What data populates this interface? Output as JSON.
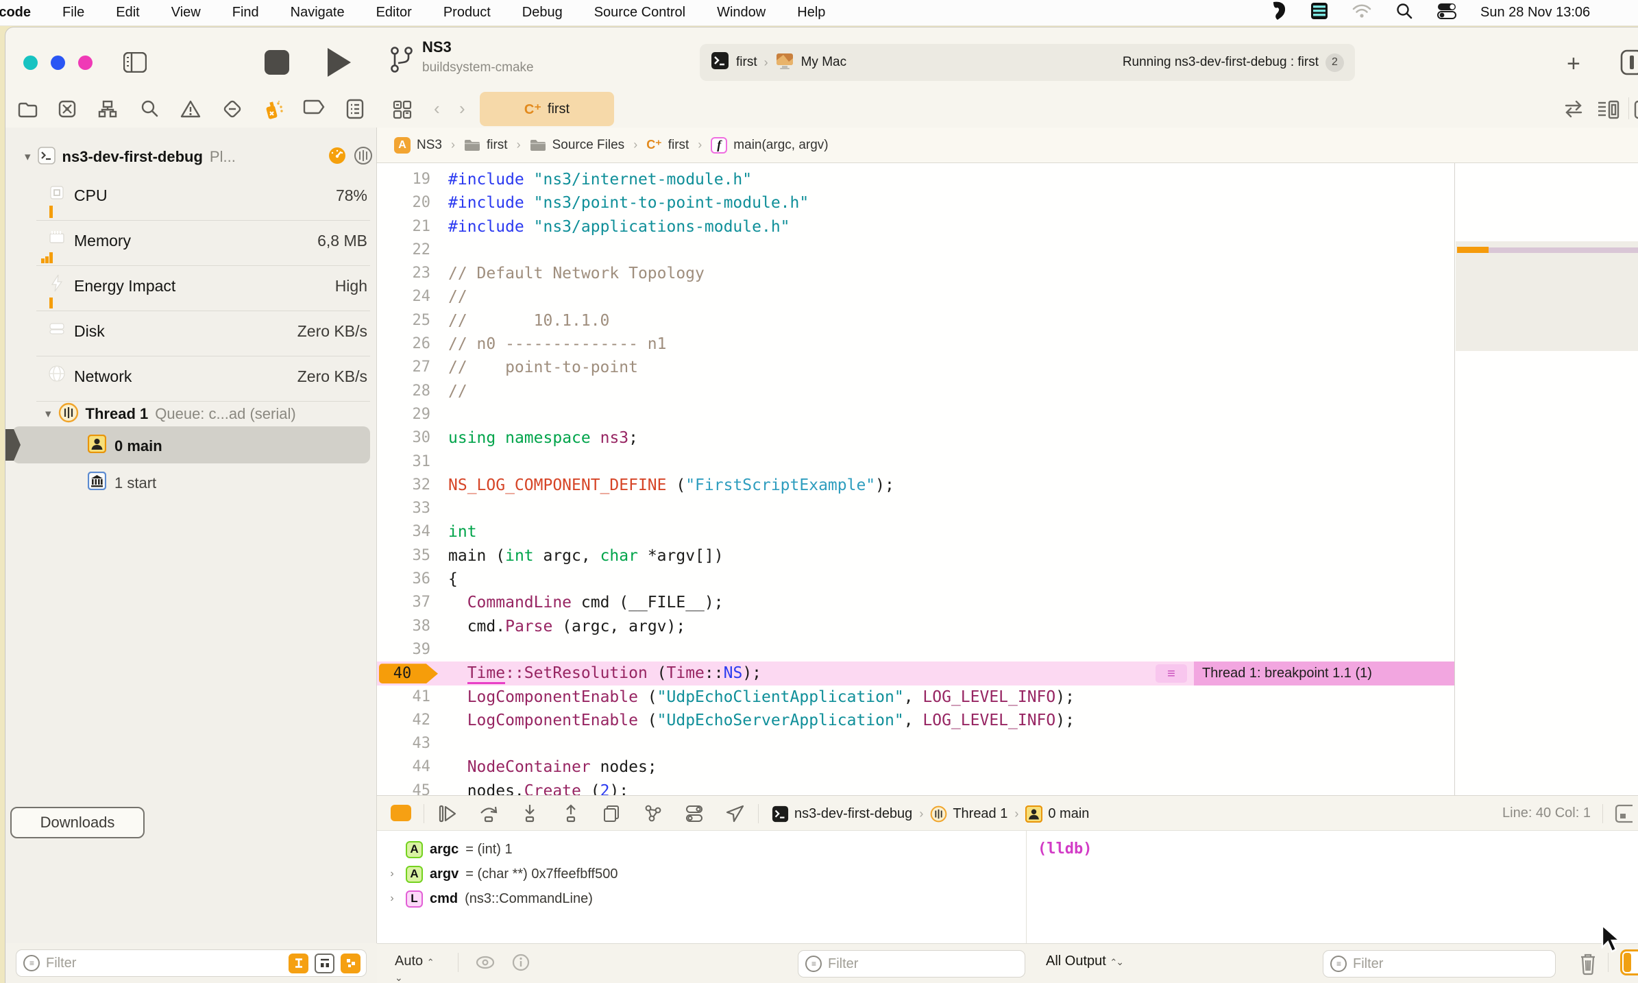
{
  "menu_bar": {
    "items": [
      "Xcode",
      "File",
      "Edit",
      "View",
      "Find",
      "Navigate",
      "Editor",
      "Product",
      "Debug",
      "Source Control",
      "Window",
      "Help"
    ],
    "clock": "Sun 28 Nov 13:06"
  },
  "toolbar": {
    "project": "NS3",
    "build_system": "buildsystem-cmake",
    "scheme_target": "first",
    "scheme_device": "My Mac",
    "run_status": "Running ns3-dev-first-debug : first",
    "run_badge": "2"
  },
  "tab_bar": {
    "active_icon": "C⁺",
    "active_label": "first"
  },
  "jump_bar": {
    "items": [
      {
        "icon": "app",
        "label": "NS3"
      },
      {
        "icon": "folder",
        "label": "first"
      },
      {
        "icon": "folder",
        "label": "Source Files"
      },
      {
        "icon": "cpp",
        "label": "first"
      },
      {
        "icon": "function",
        "label": "main(argc, argv)"
      }
    ]
  },
  "debug_navigator": {
    "process_name": "ns3-dev-first-debug",
    "process_suffix": "Pl...",
    "gauges": [
      {
        "icon": "cpu",
        "label": "CPU",
        "value": "78%",
        "bar": 18
      },
      {
        "icon": "memory",
        "label": "Memory",
        "value": "6,8 MB",
        "bar": 16
      },
      {
        "icon": "energy",
        "label": "Energy Impact",
        "value": "High",
        "bar": 16
      },
      {
        "icon": "disk",
        "label": "Disk",
        "value": "Zero KB/s",
        "bar": 0
      },
      {
        "icon": "network",
        "label": "Network",
        "value": "Zero KB/s",
        "bar": 0
      }
    ],
    "thread_name": "Thread 1",
    "thread_queue": "Queue: c...ad (serial)",
    "frames": [
      {
        "icon": "person",
        "label": "0 main",
        "selected": true
      },
      {
        "icon": "bank",
        "label": "1 start",
        "selected": false
      }
    ],
    "downloads_button": "Downloads",
    "filter_placeholder": "Filter"
  },
  "editor": {
    "breakpoint_annotation": "Thread 1: breakpoint 1.1 (1)",
    "lines": [
      {
        "n": 19,
        "t": [
          [
            "pre",
            "#include"
          ],
          [
            "pl",
            " "
          ],
          [
            "str",
            "\"ns3/internet-module.h\""
          ]
        ]
      },
      {
        "n": 20,
        "t": [
          [
            "pre",
            "#include"
          ],
          [
            "pl",
            " "
          ],
          [
            "str",
            "\"ns3/point-to-point-module.h\""
          ]
        ]
      },
      {
        "n": 21,
        "t": [
          [
            "pre",
            "#include"
          ],
          [
            "pl",
            " "
          ],
          [
            "str",
            "\"ns3/applications-module.h\""
          ]
        ]
      },
      {
        "n": 22,
        "t": []
      },
      {
        "n": 23,
        "t": [
          [
            "com",
            "// Default Network Topology"
          ]
        ]
      },
      {
        "n": 24,
        "t": [
          [
            "com",
            "//"
          ]
        ]
      },
      {
        "n": 25,
        "t": [
          [
            "com",
            "//       10.1.1.0"
          ]
        ]
      },
      {
        "n": 26,
        "t": [
          [
            "com",
            "// n0 -------------- n1"
          ]
        ]
      },
      {
        "n": 27,
        "t": [
          [
            "com",
            "//    point-to-point"
          ]
        ]
      },
      {
        "n": 28,
        "t": [
          [
            "com",
            "//"
          ]
        ]
      },
      {
        "n": 29,
        "t": []
      },
      {
        "n": 30,
        "t": [
          [
            "kw",
            "using"
          ],
          [
            "pl",
            " "
          ],
          [
            "kw",
            "namespace"
          ],
          [
            "pl",
            " "
          ],
          [
            "type",
            "ns3"
          ],
          [
            "pl",
            ";"
          ]
        ]
      },
      {
        "n": 31,
        "t": []
      },
      {
        "n": 32,
        "t": [
          [
            "macro",
            "NS_LOG_COMPONENT_DEFINE"
          ],
          [
            "pl",
            " ("
          ],
          [
            "str2",
            "\"FirstScriptExample\""
          ],
          [
            "pl",
            ");"
          ]
        ]
      },
      {
        "n": 33,
        "t": []
      },
      {
        "n": 34,
        "t": [
          [
            "kw",
            "int"
          ]
        ]
      },
      {
        "n": 35,
        "t": [
          [
            "pl",
            "main ("
          ],
          [
            "kw",
            "int"
          ],
          [
            "pl",
            " argc, "
          ],
          [
            "kw",
            "char"
          ],
          [
            "pl",
            " *argv[])"
          ]
        ]
      },
      {
        "n": 36,
        "t": [
          [
            "pl",
            "{"
          ]
        ]
      },
      {
        "n": 37,
        "t": [
          [
            "pl",
            "  "
          ],
          [
            "type",
            "CommandLine"
          ],
          [
            "pl",
            " cmd (__FILE__);"
          ]
        ]
      },
      {
        "n": 38,
        "t": [
          [
            "pl",
            "  cmd."
          ],
          [
            "type",
            "Parse"
          ],
          [
            "pl",
            " (argc, argv);"
          ]
        ]
      },
      {
        "n": 39,
        "t": []
      },
      {
        "n": 40,
        "bp": true,
        "t": [
          [
            "pl",
            "  "
          ],
          [
            "type-u",
            "Time"
          ],
          [
            "type",
            "::SetResolution"
          ],
          [
            "pl",
            " ("
          ],
          [
            "type",
            "Time"
          ],
          [
            "pl",
            "::"
          ],
          [
            "num",
            "NS"
          ],
          [
            "pl",
            ");"
          ]
        ]
      },
      {
        "n": 41,
        "t": [
          [
            "pl",
            "  "
          ],
          [
            "type",
            "LogComponentEnable"
          ],
          [
            "pl",
            " ("
          ],
          [
            "str",
            "\"UdpEchoClientApplication\""
          ],
          [
            "pl",
            ", "
          ],
          [
            "type",
            "LOG_LEVEL_INFO"
          ],
          [
            "pl",
            ");"
          ]
        ]
      },
      {
        "n": 42,
        "t": [
          [
            "pl",
            "  "
          ],
          [
            "type",
            "LogComponentEnable"
          ],
          [
            "pl",
            " ("
          ],
          [
            "str",
            "\"UdpEchoServerApplication\""
          ],
          [
            "pl",
            ", "
          ],
          [
            "type",
            "LOG_LEVEL_INFO"
          ],
          [
            "pl",
            ");"
          ]
        ]
      },
      {
        "n": 43,
        "t": []
      },
      {
        "n": 44,
        "t": [
          [
            "pl",
            "  "
          ],
          [
            "type",
            "NodeContainer"
          ],
          [
            "pl",
            " nodes;"
          ]
        ]
      },
      {
        "n": 45,
        "t": [
          [
            "pl",
            "  nodes."
          ],
          [
            "type",
            "Create"
          ],
          [
            "pl",
            " ("
          ],
          [
            "num",
            "2"
          ],
          [
            "pl",
            ");"
          ]
        ]
      }
    ]
  },
  "debug_bar": {
    "breadcrumb": [
      {
        "icon": "terminal",
        "label": "ns3-dev-first-debug"
      },
      {
        "icon": "thread",
        "label": "Thread 1"
      },
      {
        "icon": "person",
        "label": "0 main"
      }
    ],
    "line_col": "Line: 40  Col: 1"
  },
  "variables_view": {
    "rows": [
      {
        "chev": false,
        "badge": "A",
        "badge_color": "green",
        "name": "argc",
        "value": "= (int) 1"
      },
      {
        "chev": true,
        "badge": "A",
        "badge_color": "green",
        "name": "argv",
        "value": "= (char **) 0x7ffeefbff500"
      },
      {
        "chev": true,
        "badge": "L",
        "badge_color": "magenta",
        "name": "cmd",
        "value": "(ns3::CommandLine)"
      }
    ],
    "scope_selector": "Auto",
    "filter_placeholder": "Filter"
  },
  "console": {
    "prompt": "(lldb)",
    "output_selector": "All Output",
    "filter_placeholder": "Filter"
  },
  "colors": {
    "accent_orange": "#f59e0b",
    "breakpoint_row": "#fcd9f2",
    "breakpoint_annotation": "#f2a6e0",
    "active_tab": "#f6d9a9",
    "traffic_1": "#17c3c1",
    "traffic_2": "#2a56f4",
    "traffic_3": "#ef3ab6",
    "lldb_prompt": "#d23bc6"
  }
}
